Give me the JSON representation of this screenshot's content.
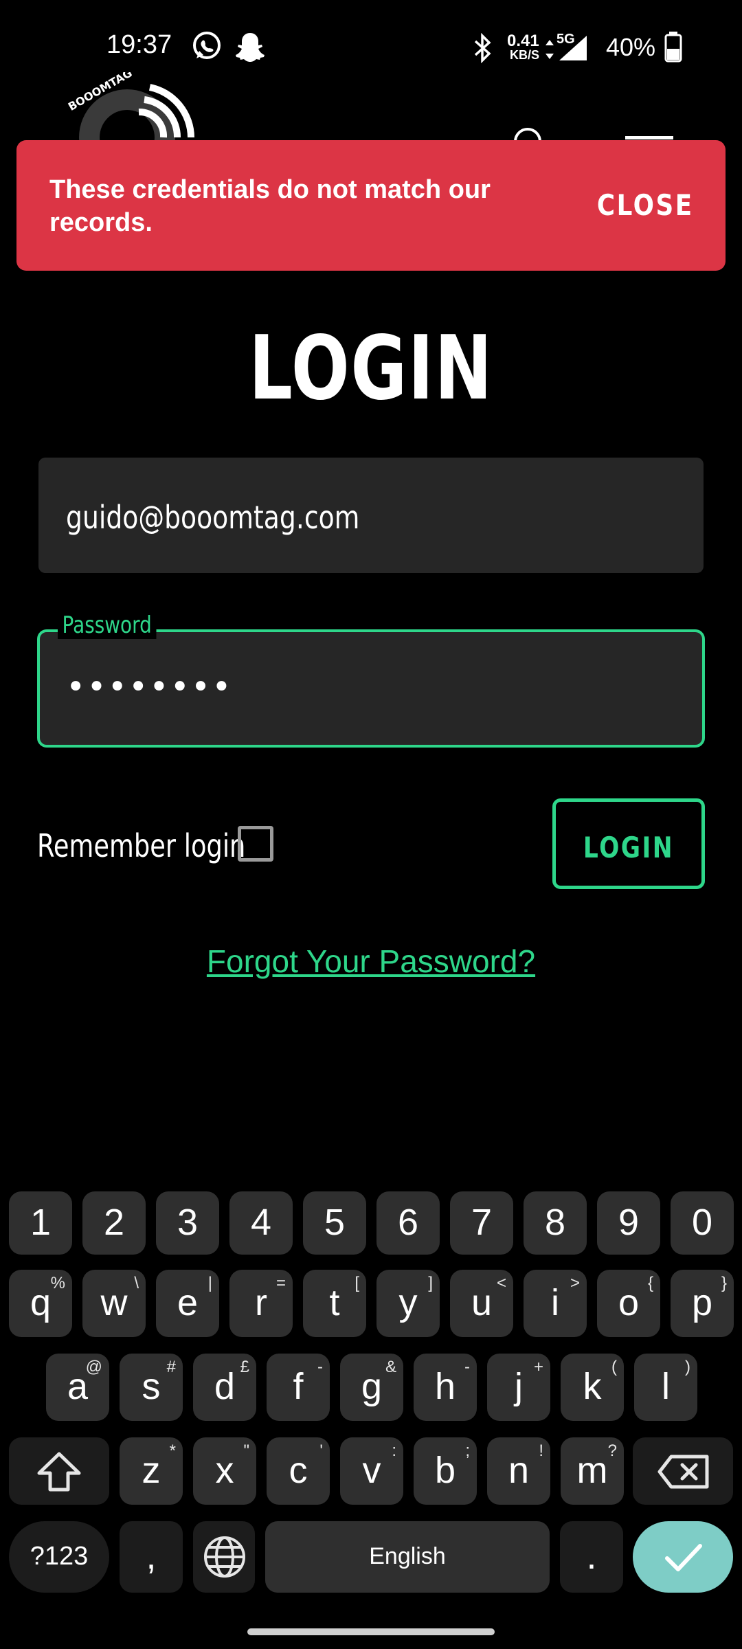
{
  "status_bar": {
    "time": "19:37",
    "net_speed_value": "0.41",
    "net_speed_unit": "KB/S",
    "network": "5G",
    "battery": "40%",
    "icons": [
      "whatsapp-icon",
      "snapchat-icon",
      "bluetooth-icon",
      "data-transfer-icon",
      "signal-icon",
      "battery-icon"
    ]
  },
  "header": {
    "logo_text": "BOOOMTAG"
  },
  "snackbar": {
    "message": "These credentials do not match our records.",
    "close_label": "CLOSE",
    "color": "#dc3545"
  },
  "login_form": {
    "title": "LOGIN",
    "email_value": "guido@booomtag.com",
    "password_label": "Password",
    "password_value": "••••••••",
    "remember_label": "Remember login",
    "remember_checked": false,
    "login_button_label": "LOGIN",
    "forgot_link": "Forgot Your Password?",
    "accent_color": "#2ed68a"
  },
  "keyboard": {
    "number_row": [
      "1",
      "2",
      "3",
      "4",
      "5",
      "6",
      "7",
      "8",
      "9",
      "0"
    ],
    "row1": [
      {
        "key": "q",
        "alt": "%"
      },
      {
        "key": "w",
        "alt": "\\"
      },
      {
        "key": "e",
        "alt": "|"
      },
      {
        "key": "r",
        "alt": "="
      },
      {
        "key": "t",
        "alt": "["
      },
      {
        "key": "y",
        "alt": "]"
      },
      {
        "key": "u",
        "alt": "<"
      },
      {
        "key": "i",
        "alt": ">"
      },
      {
        "key": "o",
        "alt": "{"
      },
      {
        "key": "p",
        "alt": "}"
      }
    ],
    "row2": [
      {
        "key": "a",
        "alt": "@"
      },
      {
        "key": "s",
        "alt": "#"
      },
      {
        "key": "d",
        "alt": "£"
      },
      {
        "key": "f",
        "alt": "-"
      },
      {
        "key": "g",
        "alt": "&"
      },
      {
        "key": "h",
        "alt": "-"
      },
      {
        "key": "j",
        "alt": "+"
      },
      {
        "key": "k",
        "alt": "("
      },
      {
        "key": "l",
        "alt": ")"
      }
    ],
    "row3": [
      {
        "key": "z",
        "alt": "*"
      },
      {
        "key": "x",
        "alt": "\""
      },
      {
        "key": "c",
        "alt": "'"
      },
      {
        "key": "v",
        "alt": ":"
      },
      {
        "key": "b",
        "alt": ";"
      },
      {
        "key": "n",
        "alt": "!"
      },
      {
        "key": "m",
        "alt": "?"
      }
    ],
    "symbols_label": "?123",
    "comma": ",",
    "space_label": "English",
    "period": ".",
    "enter_color": "#7ecdc6"
  }
}
